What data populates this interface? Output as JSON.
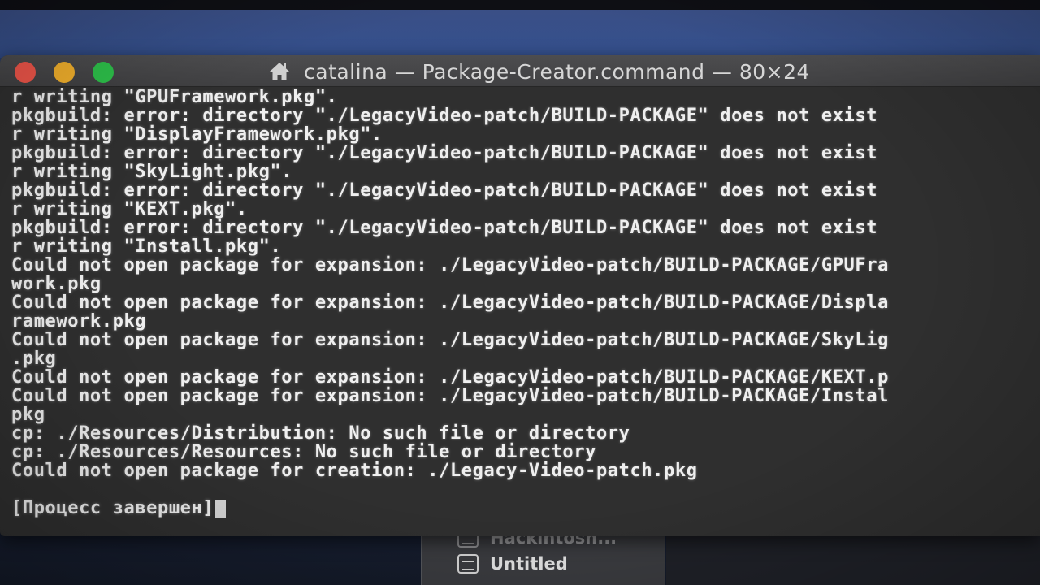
{
  "window": {
    "title": "catalina — Package-Creator.command — 80×24"
  },
  "terminal": {
    "lines": [
      "r writing \"GPUFramework.pkg\".",
      "pkgbuild: error: directory \"./LegacyVideo-patch/BUILD-PACKAGE\" does not exist",
      "r writing \"DisplayFramework.pkg\".",
      "pkgbuild: error: directory \"./LegacyVideo-patch/BUILD-PACKAGE\" does not exist",
      "r writing \"SkyLight.pkg\".",
      "pkgbuild: error: directory \"./LegacyVideo-patch/BUILD-PACKAGE\" does not exist",
      "r writing \"KEXT.pkg\".",
      "pkgbuild: error: directory \"./LegacyVideo-patch/BUILD-PACKAGE\" does not exist",
      "r writing \"Install.pkg\".",
      "Could not open package for expansion: ./LegacyVideo-patch/BUILD-PACKAGE/GPUFra",
      "work.pkg",
      "Could not open package for expansion: ./LegacyVideo-patch/BUILD-PACKAGE/Displa",
      "ramework.pkg",
      "Could not open package for expansion: ./LegacyVideo-patch/BUILD-PACKAGE/SkyLig",
      ".pkg",
      "Could not open package for expansion: ./LegacyVideo-patch/BUILD-PACKAGE/KEXT.p",
      "Could not open package for expansion: ./LegacyVideo-patch/BUILD-PACKAGE/Instal",
      "pkg",
      "cp: ./Resources/Distribution: No such file or directory",
      "cp: ./Resources/Resources: No such file or directory",
      "Could not open package for creation: ./Legacy-Video-patch.pkg"
    ],
    "process_status": "[Процесс завершен]"
  },
  "background_window": {
    "items": [
      "Hackintosh...",
      "Untitled"
    ]
  },
  "colors": {
    "close": "#f0564a",
    "minimize": "#f2b02c",
    "zoom": "#2dc04a",
    "terminal_bg": "#2f2f2f",
    "terminal_text": "#efefef"
  }
}
